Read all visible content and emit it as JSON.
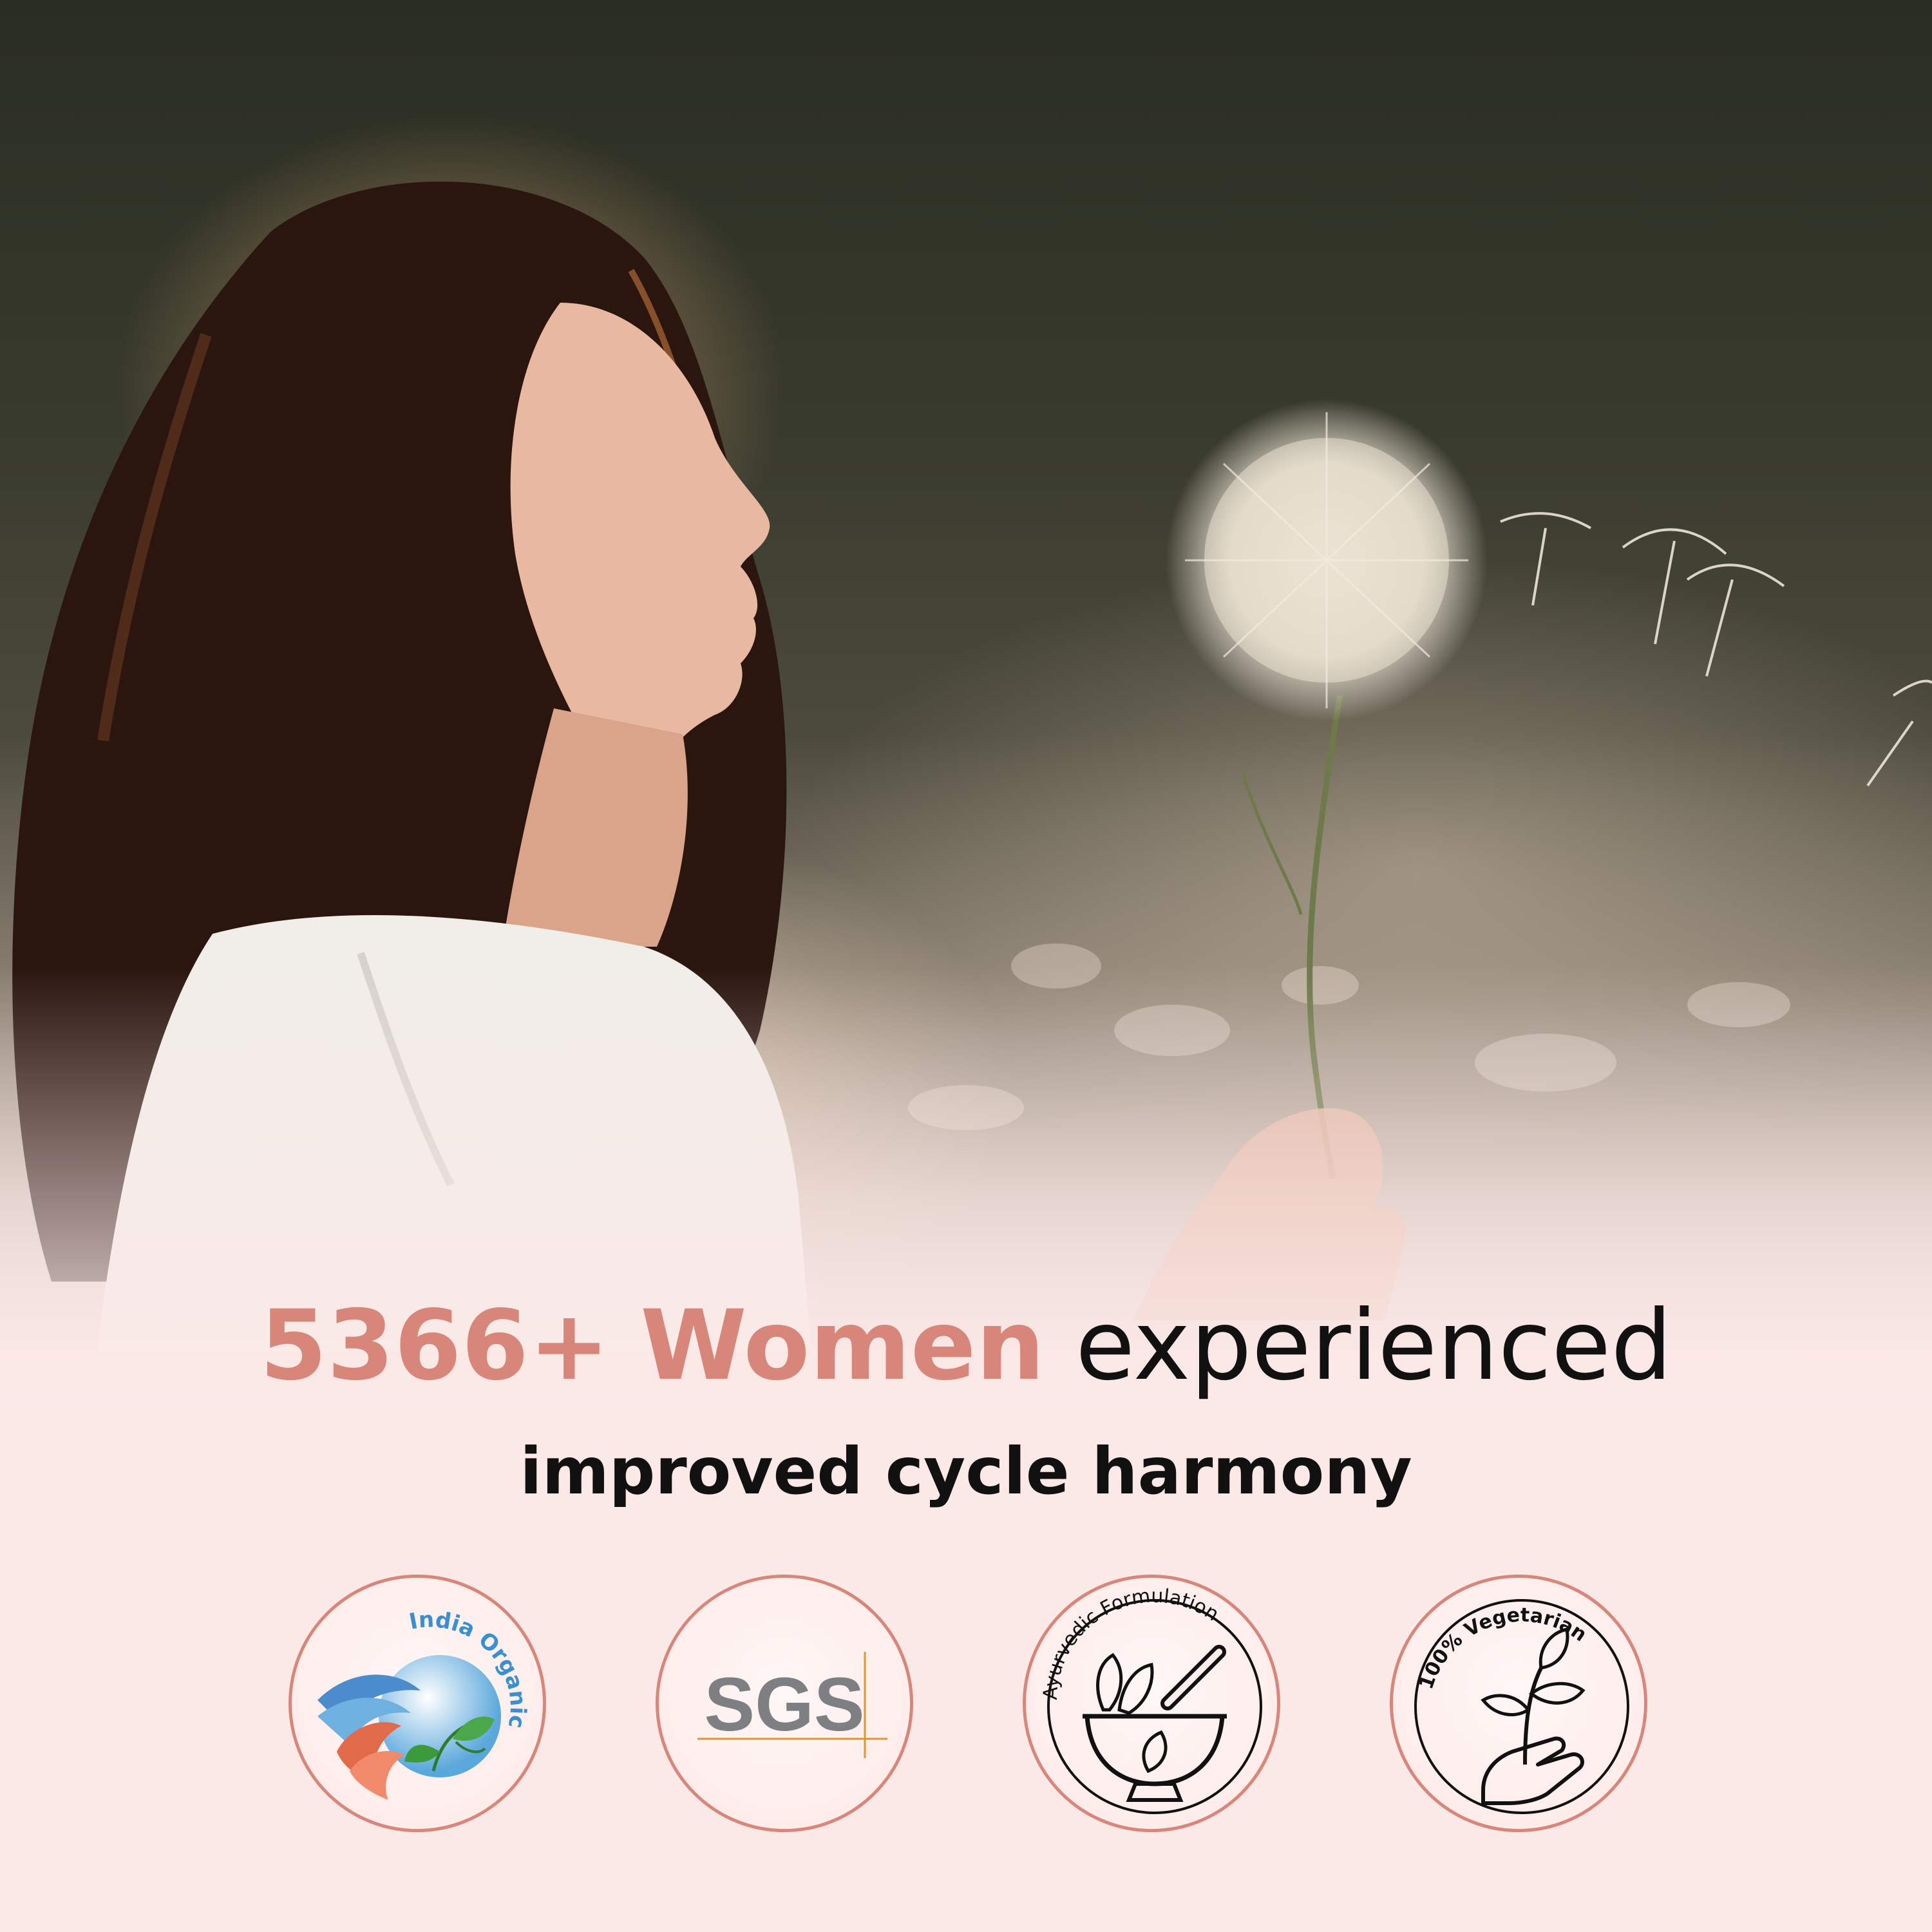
{
  "headline": {
    "count": "5366+",
    "subject": "Women",
    "verb": "experienced"
  },
  "subline": "improved cycle harmony",
  "badges": [
    {
      "label": "India Organic",
      "icon": "india-organic-logo"
    },
    {
      "label": "SGS",
      "icon": "sgs-logo"
    },
    {
      "label": "Ayurvedic Formulation",
      "icon": "mortar-pestle-icon"
    },
    {
      "label": "100% Vegetarian",
      "icon": "hand-sprout-icon"
    }
  ],
  "colors": {
    "accent": "#d8867a",
    "text": "#111111",
    "background": "#fbe9e8"
  }
}
